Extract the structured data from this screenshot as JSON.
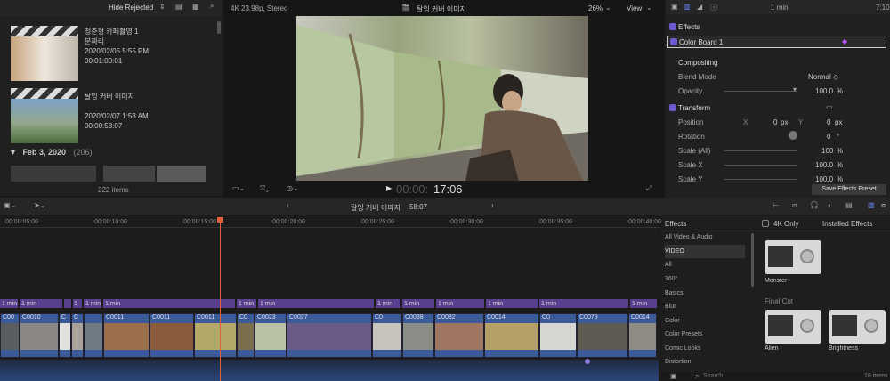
{
  "browser": {
    "filter": "Hide Rejected",
    "clips": [
      {
        "title": "청춘형 카페촬영 1분짜리",
        "date": "2020/02/05 5:55 PM",
        "duration": "00:01:00:01"
      },
      {
        "title": "탈잉 커버 이미지",
        "date": "2020/02/07 1:58 AM",
        "duration": "00:00:58:07"
      }
    ],
    "section_date": "Feb 3, 2020",
    "section_count": "(206)",
    "item_count": "222 items"
  },
  "viewer": {
    "format": "4K 23.98p, Stereo",
    "title": "탈잉 커버 이미지",
    "zoom": "26%",
    "view": "View",
    "timecode_dim": "00:00:",
    "timecode": "17:06"
  },
  "inspector": {
    "duration": "1 min",
    "timecode_right": "7:10",
    "effects_title": "Effects",
    "color_board": "Color Board 1",
    "compositing": "Compositing",
    "blend_mode_label": "Blend Mode",
    "blend_mode_value": "Normal ◇",
    "opacity_label": "Opacity",
    "opacity_value": "100.0",
    "transform_title": "Transform",
    "position_label": "Position",
    "pos_x_label": "X",
    "pos_x_value": "0",
    "pos_y_label": "Y",
    "pos_y_value": "0",
    "px_unit": "px",
    "rotation_label": "Rotation",
    "rotation_value": "0",
    "deg_unit": "°",
    "pct_unit": "%",
    "scale_all_label": "Scale (All)",
    "scale_all_value": "100",
    "scale_x_label": "Scale X",
    "scale_x_value": "100.0",
    "scale_y_label": "Scale Y",
    "scale_y_value": "100.0",
    "save_preset": "Save Effects Preset"
  },
  "timeline": {
    "title": "탈잉 커버 이미지",
    "duration": "58:07",
    "ruler": [
      "00:00:05:00",
      "00:00:10:00",
      "00:00:15:00",
      "00:00:20:00",
      "00:00:25:00",
      "00:00:30:00",
      "00:00:35:00",
      "00:00:40:00"
    ],
    "label_chips": [
      "1 min",
      "1 min",
      "1 min",
      "1",
      "1 min",
      "1 min",
      "1 min",
      "1 min",
      "1 min",
      "1 min",
      "1 min",
      "1 min",
      "1 min",
      "1 min"
    ],
    "clips": [
      "C00",
      "C0010",
      "C",
      "C",
      "C0011",
      "C0011",
      "C0011",
      "C0",
      "C0023",
      "C0027",
      "C0",
      "C0038",
      "C0032",
      "C0014",
      "C0",
      "C0079",
      "C0014"
    ]
  },
  "effects": {
    "header": "Effects",
    "filter_4k": "4K Only",
    "installed": "Installed Effects",
    "categories": [
      "All Video & Audio",
      "VIDEO",
      "All",
      "360°",
      "Basics",
      "Blur",
      "Color",
      "Color Presets",
      "Comic Looks",
      "Distortion"
    ],
    "featured": "Monster",
    "group": "Final Cut",
    "items": [
      "Alien",
      "Brightness"
    ],
    "search_placeholder": "Search",
    "count": "18 items"
  }
}
